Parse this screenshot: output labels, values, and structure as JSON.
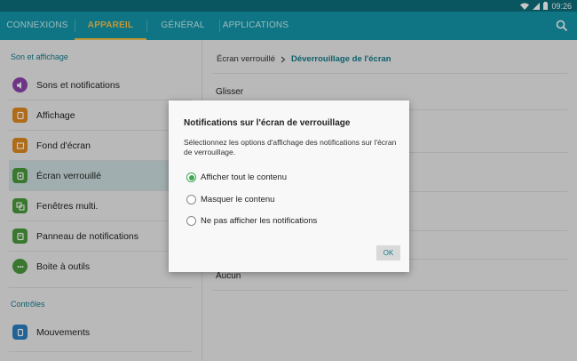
{
  "status": {
    "time": "09:26"
  },
  "tabs": [
    {
      "label": "CONNEXIONS"
    },
    {
      "label": "APPAREIL"
    },
    {
      "label": "GÉNÉRAL"
    },
    {
      "label": "APPLICATIONS"
    }
  ],
  "sidebar": {
    "section1": "Son et affichage",
    "items": [
      {
        "label": "Sons et notifications",
        "icon": "volume-icon",
        "color": "#8e44ad"
      },
      {
        "label": "Affichage",
        "icon": "display-icon",
        "color": "#e08a1e"
      },
      {
        "label": "Fond d'écran",
        "icon": "wallpaper-icon",
        "color": "#e08a1e"
      },
      {
        "label": "Écran verrouillé",
        "icon": "lock-screen-icon",
        "color": "#4a9a3c"
      },
      {
        "label": "Fenêtres multi.",
        "icon": "multi-window-icon",
        "color": "#4a9a3c"
      },
      {
        "label": "Panneau de notifications",
        "icon": "notification-panel-icon",
        "color": "#4a9a3c"
      },
      {
        "label": "Boite à outils",
        "icon": "toolbox-icon",
        "color": "#4a9a3c"
      }
    ],
    "section2": "Contrôles",
    "items2": [
      {
        "label": "Mouvements",
        "icon": "motion-icon",
        "color": "#2b7fc2"
      }
    ]
  },
  "main": {
    "breadcrumb": {
      "parent": "Écran verrouillé",
      "current": "Déverrouillage de l'écran"
    },
    "options": [
      "Glisser",
      "Aucun"
    ]
  },
  "dialog": {
    "title": "Notifications sur l'écran de verrouillage",
    "description": "Sélectionnez les options d'affichage des notifications sur l'écran de verrouillage.",
    "options": [
      {
        "label": "Afficher tout le contenu",
        "selected": true
      },
      {
        "label": "Masquer le contenu",
        "selected": false
      },
      {
        "label": "Ne pas afficher les notifications",
        "selected": false
      }
    ],
    "ok_label": "OK"
  },
  "colors": {
    "accent": "#1497a9",
    "tab_active": "#f6c24a",
    "section": "#137c8b"
  }
}
